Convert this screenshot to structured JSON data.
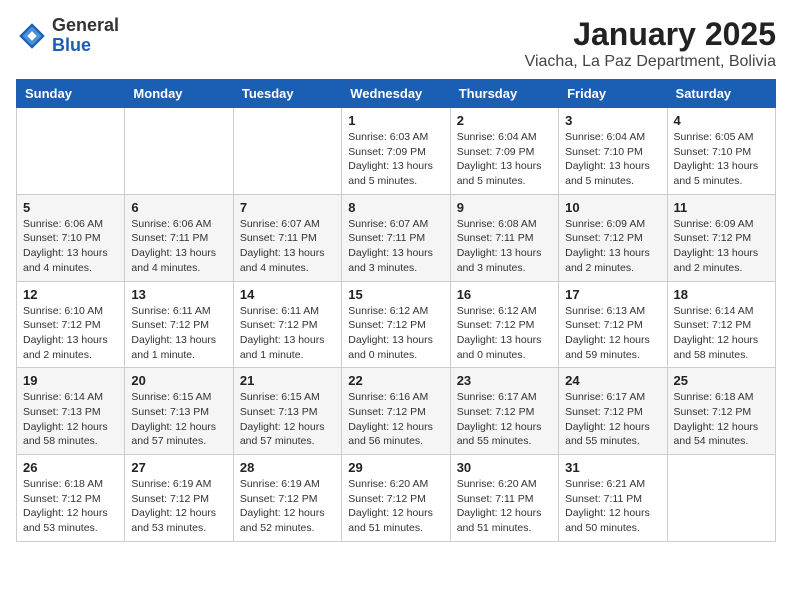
{
  "logo": {
    "general": "General",
    "blue": "Blue"
  },
  "header": {
    "month": "January 2025",
    "location": "Viacha, La Paz Department, Bolivia"
  },
  "weekdays": [
    "Sunday",
    "Monday",
    "Tuesday",
    "Wednesday",
    "Thursday",
    "Friday",
    "Saturday"
  ],
  "weeks": [
    [
      {
        "day": "",
        "info": ""
      },
      {
        "day": "",
        "info": ""
      },
      {
        "day": "",
        "info": ""
      },
      {
        "day": "1",
        "info": "Sunrise: 6:03 AM\nSunset: 7:09 PM\nDaylight: 13 hours\nand 5 minutes."
      },
      {
        "day": "2",
        "info": "Sunrise: 6:04 AM\nSunset: 7:09 PM\nDaylight: 13 hours\nand 5 minutes."
      },
      {
        "day": "3",
        "info": "Sunrise: 6:04 AM\nSunset: 7:10 PM\nDaylight: 13 hours\nand 5 minutes."
      },
      {
        "day": "4",
        "info": "Sunrise: 6:05 AM\nSunset: 7:10 PM\nDaylight: 13 hours\nand 5 minutes."
      }
    ],
    [
      {
        "day": "5",
        "info": "Sunrise: 6:06 AM\nSunset: 7:10 PM\nDaylight: 13 hours\nand 4 minutes."
      },
      {
        "day": "6",
        "info": "Sunrise: 6:06 AM\nSunset: 7:11 PM\nDaylight: 13 hours\nand 4 minutes."
      },
      {
        "day": "7",
        "info": "Sunrise: 6:07 AM\nSunset: 7:11 PM\nDaylight: 13 hours\nand 4 minutes."
      },
      {
        "day": "8",
        "info": "Sunrise: 6:07 AM\nSunset: 7:11 PM\nDaylight: 13 hours\nand 3 minutes."
      },
      {
        "day": "9",
        "info": "Sunrise: 6:08 AM\nSunset: 7:11 PM\nDaylight: 13 hours\nand 3 minutes."
      },
      {
        "day": "10",
        "info": "Sunrise: 6:09 AM\nSunset: 7:12 PM\nDaylight: 13 hours\nand 2 minutes."
      },
      {
        "day": "11",
        "info": "Sunrise: 6:09 AM\nSunset: 7:12 PM\nDaylight: 13 hours\nand 2 minutes."
      }
    ],
    [
      {
        "day": "12",
        "info": "Sunrise: 6:10 AM\nSunset: 7:12 PM\nDaylight: 13 hours\nand 2 minutes."
      },
      {
        "day": "13",
        "info": "Sunrise: 6:11 AM\nSunset: 7:12 PM\nDaylight: 13 hours\nand 1 minute."
      },
      {
        "day": "14",
        "info": "Sunrise: 6:11 AM\nSunset: 7:12 PM\nDaylight: 13 hours\nand 1 minute."
      },
      {
        "day": "15",
        "info": "Sunrise: 6:12 AM\nSunset: 7:12 PM\nDaylight: 13 hours\nand 0 minutes."
      },
      {
        "day": "16",
        "info": "Sunrise: 6:12 AM\nSunset: 7:12 PM\nDaylight: 13 hours\nand 0 minutes."
      },
      {
        "day": "17",
        "info": "Sunrise: 6:13 AM\nSunset: 7:12 PM\nDaylight: 12 hours\nand 59 minutes."
      },
      {
        "day": "18",
        "info": "Sunrise: 6:14 AM\nSunset: 7:12 PM\nDaylight: 12 hours\nand 58 minutes."
      }
    ],
    [
      {
        "day": "19",
        "info": "Sunrise: 6:14 AM\nSunset: 7:13 PM\nDaylight: 12 hours\nand 58 minutes."
      },
      {
        "day": "20",
        "info": "Sunrise: 6:15 AM\nSunset: 7:13 PM\nDaylight: 12 hours\nand 57 minutes."
      },
      {
        "day": "21",
        "info": "Sunrise: 6:15 AM\nSunset: 7:13 PM\nDaylight: 12 hours\nand 57 minutes."
      },
      {
        "day": "22",
        "info": "Sunrise: 6:16 AM\nSunset: 7:12 PM\nDaylight: 12 hours\nand 56 minutes."
      },
      {
        "day": "23",
        "info": "Sunrise: 6:17 AM\nSunset: 7:12 PM\nDaylight: 12 hours\nand 55 minutes."
      },
      {
        "day": "24",
        "info": "Sunrise: 6:17 AM\nSunset: 7:12 PM\nDaylight: 12 hours\nand 55 minutes."
      },
      {
        "day": "25",
        "info": "Sunrise: 6:18 AM\nSunset: 7:12 PM\nDaylight: 12 hours\nand 54 minutes."
      }
    ],
    [
      {
        "day": "26",
        "info": "Sunrise: 6:18 AM\nSunset: 7:12 PM\nDaylight: 12 hours\nand 53 minutes."
      },
      {
        "day": "27",
        "info": "Sunrise: 6:19 AM\nSunset: 7:12 PM\nDaylight: 12 hours\nand 53 minutes."
      },
      {
        "day": "28",
        "info": "Sunrise: 6:19 AM\nSunset: 7:12 PM\nDaylight: 12 hours\nand 52 minutes."
      },
      {
        "day": "29",
        "info": "Sunrise: 6:20 AM\nSunset: 7:12 PM\nDaylight: 12 hours\nand 51 minutes."
      },
      {
        "day": "30",
        "info": "Sunrise: 6:20 AM\nSunset: 7:11 PM\nDaylight: 12 hours\nand 51 minutes."
      },
      {
        "day": "31",
        "info": "Sunrise: 6:21 AM\nSunset: 7:11 PM\nDaylight: 12 hours\nand 50 minutes."
      },
      {
        "day": "",
        "info": ""
      }
    ]
  ]
}
